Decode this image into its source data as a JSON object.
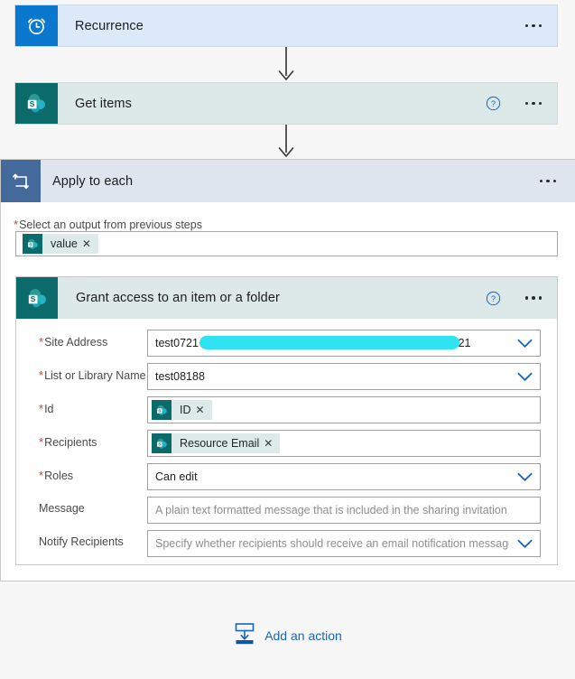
{
  "flow": {
    "steps": [
      {
        "id": "recurrence",
        "title": "Recurrence",
        "icon": "alarm-clock-icon",
        "tile_color": "#0b78d0",
        "header_color": "#dce9f8",
        "has_help": false
      },
      {
        "id": "get-items",
        "title": "Get items",
        "icon": "sharepoint-icon",
        "tile_color": "#0b6a6a",
        "header_color": "#dde9e8",
        "has_help": true
      }
    ],
    "scope": {
      "title": "Apply to each",
      "icon": "loop-icon",
      "tile_color": "#44699b",
      "header_color": "#dfe5ee",
      "select_output": {
        "label": "Select an output from previous steps",
        "required": true,
        "token": {
          "text": "value",
          "icon": "sharepoint-icon",
          "remove_label": "✕"
        }
      },
      "action": {
        "title": "Grant access to an item or a folder",
        "icon": "sharepoint-icon",
        "tile_color": "#0b6a6a",
        "header_color": "#dde9e8",
        "has_help": true,
        "fields": [
          {
            "label": "Site Address",
            "required": true,
            "type": "dropdown",
            "value": "test0721 - https://xxxxxx-548128.sharepoint.com/sites/test0721",
            "redacted": true,
            "redaction_color": "#2fe4f0"
          },
          {
            "label": "List or Library Name",
            "required": true,
            "type": "dropdown",
            "value": "test08188",
            "redacted": false
          },
          {
            "label": "Id",
            "required": true,
            "type": "token",
            "token": {
              "text": "ID",
              "icon": "sharepoint-icon",
              "remove_label": "✕"
            }
          },
          {
            "label": "Recipients",
            "required": true,
            "type": "token",
            "token": {
              "text": "Resource Email",
              "icon": "sharepoint-icon",
              "remove_label": "✕"
            }
          },
          {
            "label": "Roles",
            "required": true,
            "type": "dropdown",
            "value": "Can edit",
            "redacted": false
          },
          {
            "label": "Message",
            "required": false,
            "type": "text",
            "placeholder": "A plain text formatted message that is included in the sharing invitation"
          },
          {
            "label": "Notify Recipients",
            "required": false,
            "type": "dropdown",
            "placeholder": "Specify whether recipients should receive an email notification message"
          }
        ]
      }
    }
  },
  "footer": {
    "add_action_label": "Add an action",
    "add_action_icon": "insert-below-icon",
    "link_color": "#1565c0"
  },
  "icons": {
    "help": "question-circle-icon",
    "more": "ellipsis-icon",
    "chevron": "chevron-down-icon",
    "arrow": "arrow-down-icon"
  }
}
